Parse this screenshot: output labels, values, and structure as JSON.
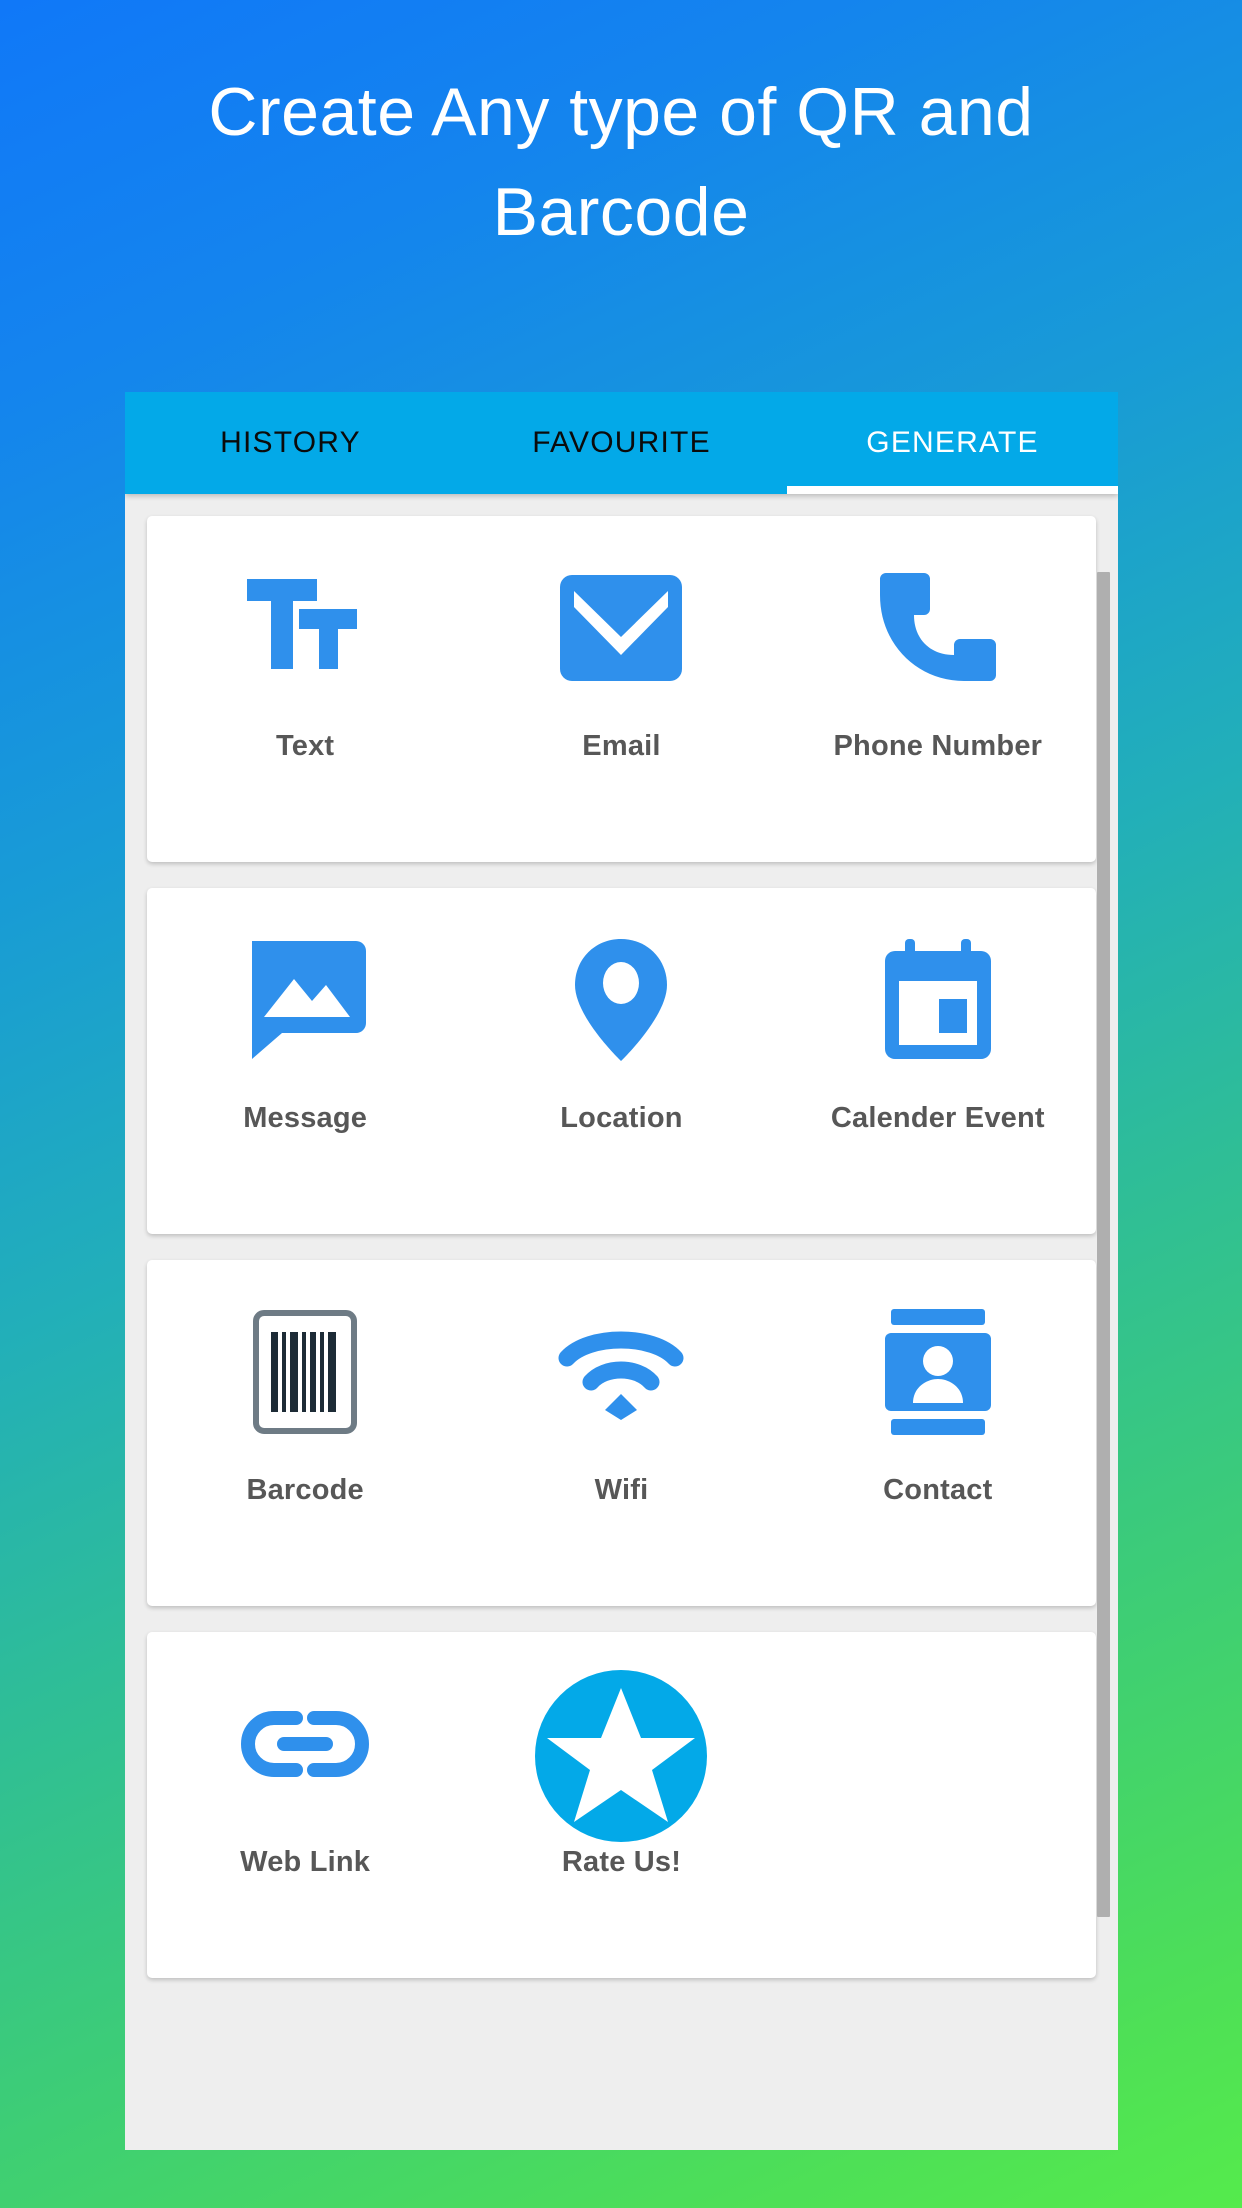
{
  "headline": "Create Any type of QR and\nBarcode",
  "colors": {
    "bg_gradient_start": "#1078F8",
    "bg_gradient_end": "#55EB4C",
    "tab_bar": "#03A9E8",
    "icon_blue": "#2F90EC",
    "accent_cyan": "#03A9E8",
    "label_text": "#575757",
    "panel_bg": "#EEEEEE",
    "card_bg": "#FFFFFF",
    "scrollbar": "#AFAFAF"
  },
  "tabs": [
    {
      "label": "HISTORY",
      "active": false
    },
    {
      "label": "FAVOURITE",
      "active": false
    },
    {
      "label": "GENERATE",
      "active": true
    }
  ],
  "grid": {
    "rows": [
      {
        "cells": [
          {
            "label": "Text",
            "icon": "text-format-icon"
          },
          {
            "label": "Email",
            "icon": "email-envelope-icon"
          },
          {
            "label": "Phone Number",
            "icon": "phone-call-icon"
          }
        ]
      },
      {
        "cells": [
          {
            "label": "Message",
            "icon": "message-image-icon"
          },
          {
            "label": "Location",
            "icon": "location-pin-icon"
          },
          {
            "label": "Calender Event",
            "icon": "calendar-icon"
          }
        ]
      },
      {
        "cells": [
          {
            "label": "Barcode",
            "icon": "barcode-icon"
          },
          {
            "label": "Wifi",
            "icon": "wifi-icon"
          },
          {
            "label": "Contact",
            "icon": "contact-card-icon"
          }
        ]
      },
      {
        "cells": [
          {
            "label": "Web Link",
            "icon": "chain-link-icon"
          },
          {
            "label": "Rate Us!",
            "icon": "star-circle-icon"
          },
          {
            "label": "",
            "icon": ""
          }
        ]
      }
    ]
  }
}
